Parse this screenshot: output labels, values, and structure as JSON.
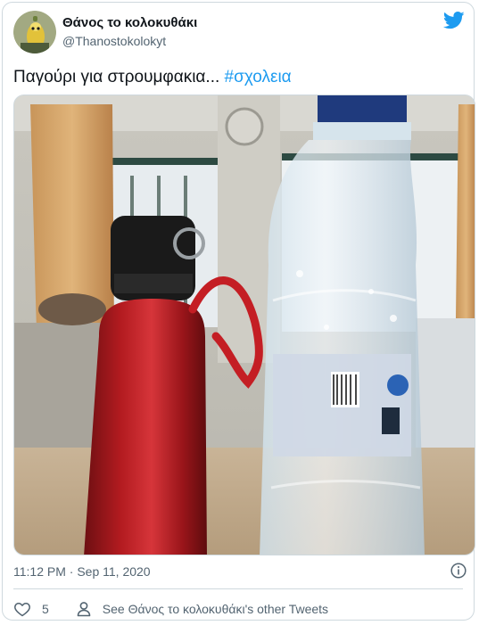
{
  "author": {
    "name": "Θάνος το κολοκυθάκι",
    "handle": "@Thanostokolokyt"
  },
  "tweet": {
    "text": "Παγούρι για στρουμφακια...",
    "hashtag": "#σχολεια",
    "timestamp": "11:12 PM · Sep 11, 2020"
  },
  "actions": {
    "like_count": "5",
    "other_tweets_label": "See Θάνος το κολοκυθάκι's other Tweets"
  },
  "icons": {
    "brand": "twitter-bird-icon",
    "info": "info-icon",
    "like": "heart-icon",
    "profile": "person-icon"
  },
  "colors": {
    "accent": "#1d9bf0",
    "text": "#0f1419",
    "muted": "#536471",
    "border": "#cfd9de"
  }
}
